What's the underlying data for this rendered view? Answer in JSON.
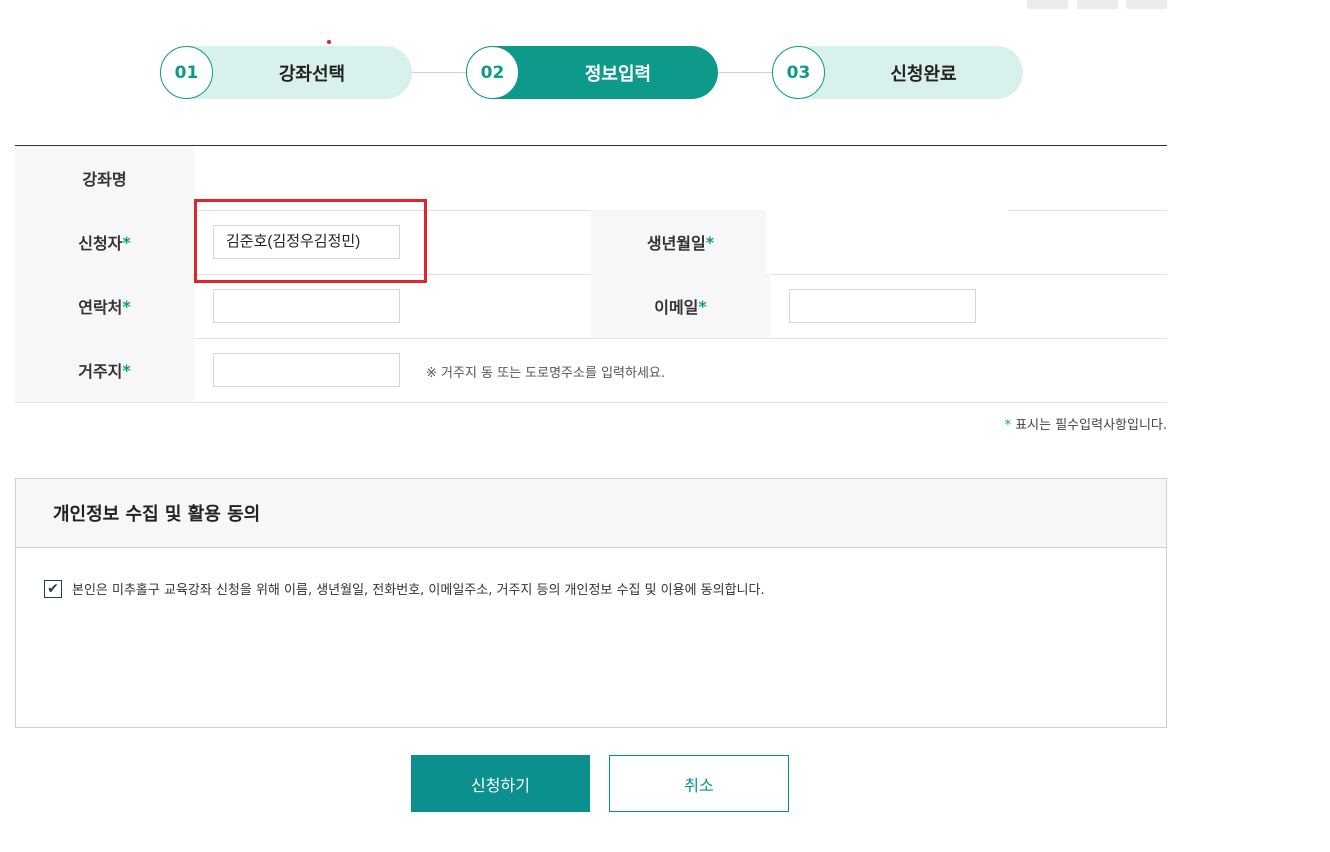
{
  "steps": [
    {
      "num": "01",
      "label": "강좌선택"
    },
    {
      "num": "02",
      "label": "정보입력"
    },
    {
      "num": "03",
      "label": "신청완료"
    }
  ],
  "form": {
    "course_label": "강좌명",
    "course_value": "",
    "applicant_label": "신청자",
    "applicant_value": "김준호(김정우김정민)",
    "birth_label": "생년월일",
    "contact_label": "연락처",
    "contact_value": "",
    "email_label": "이메일",
    "email_value": "",
    "address_label": "거주지",
    "address_value": "",
    "address_hint": "※ 거주지 동 또는 도로명주소를 입력하세요.",
    "required_mark": "*"
  },
  "required_note": {
    "mark": "*",
    "text": " 표시는 필수입력사항입니다."
  },
  "consent": {
    "title": "개인정보 수집 및 활용 동의",
    "checked": true,
    "check_glyph": "✔",
    "text": "본인은 미추홀구 교육강좌 신청을 위해 이름, 생년월일, 전화번호, 이메일주소, 거주지 등의 개인정보 수집 및 이용에 동의합니다."
  },
  "buttons": {
    "submit": "신청하기",
    "cancel": "취소"
  },
  "colors": {
    "accent": "#0e9a8a",
    "step_inactive": "#d9f1ec",
    "button": "#0c8f8f",
    "highlight": "#e0262b"
  }
}
